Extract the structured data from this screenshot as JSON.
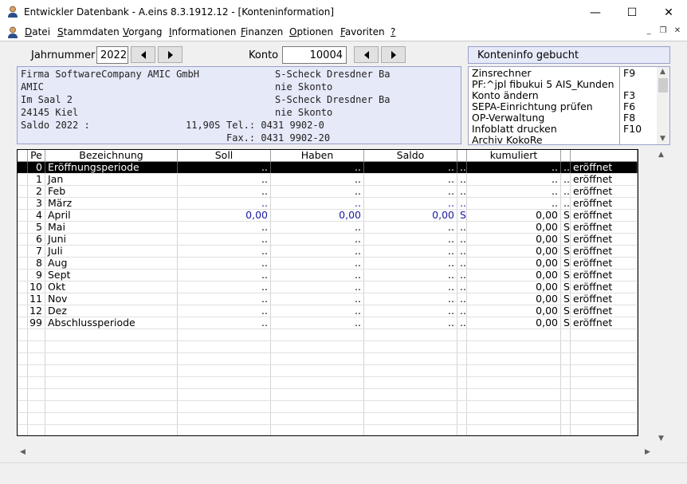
{
  "window": {
    "title": "Entwickler Datenbank - A.eins 8.3.1912.12 - [Konteninformation]",
    "minimize": "—",
    "maximize": "☐",
    "close": "✕"
  },
  "menu": {
    "items": [
      {
        "key": "D",
        "rest": "atei"
      },
      {
        "key": "S",
        "rest": "tammdaten"
      },
      {
        "key": "V",
        "rest": "organg"
      },
      {
        "key": "I",
        "rest": "nformationen"
      },
      {
        "key": "F",
        "rest": "inanzen"
      },
      {
        "key": "O",
        "rest": "ptionen"
      },
      {
        "key": "F",
        "rest": "avoriten"
      },
      {
        "key": "?",
        "rest": ""
      }
    ],
    "mdi_minimize": "_",
    "mdi_restore": "❐",
    "mdi_close": "✕"
  },
  "form": {
    "jahr_label": "Jahrnummer",
    "jahr_value": "2022",
    "konto_label": "Konto",
    "konto_value": "10004"
  },
  "info": {
    "left_lines": [
      "Firma SoftwareCompany AMIC GmbH",
      "AMIC",
      "Im Saal 2",
      "24145 Kiel",
      "Saldo 2022 :"
    ],
    "saldo_value": "11,90S",
    "right_lines": [
      "S-Scheck Dresdner Ba",
      "nie Skonto",
      "S-Scheck Dresdner Ba",
      "nie Skonto",
      "Tel.: 0431 9902-0",
      "Fax.: 0431 9902-20"
    ]
  },
  "panel": {
    "header": "Konteninfo gebucht",
    "actions": [
      {
        "label": "Zinsrechner",
        "key": "F9"
      },
      {
        "label": "PF:^jpl fibukui 5 AIS_Kunden",
        "key": ""
      },
      {
        "label": "Konto ändern",
        "key": "F3"
      },
      {
        "label": "SEPA-Einrichtung prüfen",
        "key": "F6"
      },
      {
        "label": "OP-Verwaltung",
        "key": "F8"
      },
      {
        "label": "Infoblatt drucken",
        "key": "F10"
      },
      {
        "label": "Archiv KokoRe",
        "key": ""
      }
    ]
  },
  "table": {
    "columns": [
      "Pe",
      "Bezeichnung",
      "Soll",
      "Haben",
      "Saldo",
      "",
      "kumuliert",
      "",
      ""
    ],
    "rows": [
      {
        "pe": "0",
        "name": "Eröffnungsperiode",
        "soll": "..",
        "haben": "..",
        "saldo": "..",
        "s1": "..",
        "kum": "..",
        "s2": "..",
        "status": "eröffnet",
        "selected": true,
        "blue": false
      },
      {
        "pe": "1",
        "name": "Jan",
        "soll": "..",
        "haben": "..",
        "saldo": "..",
        "s1": "..",
        "kum": "..",
        "s2": "..",
        "status": "eröffnet",
        "blue": false
      },
      {
        "pe": "2",
        "name": "Feb",
        "soll": "..",
        "haben": "..",
        "saldo": "..",
        "s1": "..",
        "kum": "..",
        "s2": "..",
        "status": "eröffnet",
        "blue": false
      },
      {
        "pe": "3",
        "name": "März",
        "soll": "..",
        "haben": "..",
        "saldo": "..",
        "s1": "..",
        "kum": "..",
        "s2": "..",
        "status": "eröffnet",
        "blue": true
      },
      {
        "pe": "4",
        "name": "April",
        "soll": "0,00",
        "haben": "0,00",
        "saldo": "0,00",
        "s1": "S",
        "kum": "0,00",
        "s2": "S",
        "status": "eröffnet",
        "blue": true
      },
      {
        "pe": "5",
        "name": "Mai",
        "soll": "..",
        "haben": "..",
        "saldo": "..",
        "s1": "..",
        "kum": "0,00",
        "s2": "S",
        "status": "eröffnet",
        "blue": false
      },
      {
        "pe": "6",
        "name": "Juni",
        "soll": "..",
        "haben": "..",
        "saldo": "..",
        "s1": "..",
        "kum": "0,00",
        "s2": "S",
        "status": "eröffnet",
        "blue": false
      },
      {
        "pe": "7",
        "name": "Juli",
        "soll": "..",
        "haben": "..",
        "saldo": "..",
        "s1": "..",
        "kum": "0,00",
        "s2": "S",
        "status": "eröffnet",
        "blue": false
      },
      {
        "pe": "8",
        "name": "Aug",
        "soll": "..",
        "haben": "..",
        "saldo": "..",
        "s1": "..",
        "kum": "0,00",
        "s2": "S",
        "status": "eröffnet",
        "blue": false
      },
      {
        "pe": "9",
        "name": "Sept",
        "soll": "..",
        "haben": "..",
        "saldo": "..",
        "s1": "..",
        "kum": "0,00",
        "s2": "S",
        "status": "eröffnet",
        "blue": false
      },
      {
        "pe": "10",
        "name": "Okt",
        "soll": "..",
        "haben": "..",
        "saldo": "..",
        "s1": "..",
        "kum": "0,00",
        "s2": "S",
        "status": "eröffnet",
        "blue": false
      },
      {
        "pe": "11",
        "name": "Nov",
        "soll": "..",
        "haben": "..",
        "saldo": "..",
        "s1": "..",
        "kum": "0,00",
        "s2": "S",
        "status": "eröffnet",
        "blue": false
      },
      {
        "pe": "12",
        "name": "Dez",
        "soll": "..",
        "haben": "..",
        "saldo": "..",
        "s1": "..",
        "kum": "0,00",
        "s2": "S",
        "status": "eröffnet",
        "blue": false
      },
      {
        "pe": "99",
        "name": "Abschlussperiode",
        "soll": "..",
        "haben": "..",
        "saldo": "..",
        "s1": "..",
        "kum": "0,00",
        "s2": "S",
        "status": "eröffnet",
        "blue": false
      }
    ]
  },
  "colors": {
    "panel_bg": "#e6e9f8",
    "blue_value": "#1a1aa0",
    "selection": "#000000"
  }
}
